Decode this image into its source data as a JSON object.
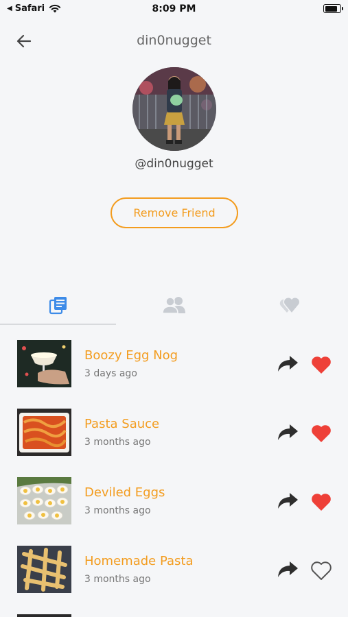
{
  "status_bar": {
    "carrier": "Safari",
    "time": "8:09 PM",
    "battery_level": 0.9
  },
  "header": {
    "title": "din0nugget",
    "back_icon": "arrow-left-icon"
  },
  "profile": {
    "username": "@din0nugget",
    "remove_friend_label": "Remove Friend"
  },
  "tabs": [
    {
      "name": "recipes",
      "icon": "recipe-list-icon",
      "active": true
    },
    {
      "name": "friends",
      "icon": "users-icon",
      "active": false
    },
    {
      "name": "liked",
      "icon": "hearts-icon",
      "active": false
    }
  ],
  "colors": {
    "accent": "#f39c1e",
    "active_tab": "#3d8be8",
    "inactive_tab": "#c8ccd2",
    "liked": "#ee4038",
    "background": "#f5f6f8"
  },
  "recipes": [
    {
      "title": "Boozy Egg Nog",
      "time": "3 days ago",
      "liked": true
    },
    {
      "title": "Pasta Sauce",
      "time": "3 months ago",
      "liked": true
    },
    {
      "title": "Deviled Eggs",
      "time": "3 months ago",
      "liked": true
    },
    {
      "title": "Homemade Pasta",
      "time": "3 months ago",
      "liked": false
    }
  ]
}
